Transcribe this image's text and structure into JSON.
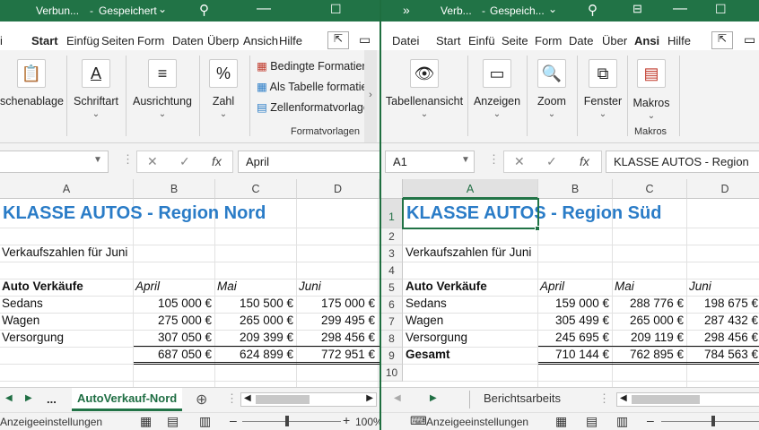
{
  "left": {
    "title": {
      "file": "Verbun...",
      "sep": "-",
      "state": "Gespeichert"
    },
    "tabs": [
      "Start",
      "Einfüg",
      "Seiten",
      "Form",
      "Daten",
      "Überp",
      "Ansich",
      "Hilfe"
    ],
    "tab_partial_first": "i",
    "active_tab": "Start",
    "ribbon": {
      "clipboard": "schenablage",
      "font": "Schriftart",
      "alignment": "Ausrichtung",
      "number": "Zahl",
      "styles": [
        "Bedingte Formatierung",
        "Als Tabelle formatieren",
        "Zellenformatvorlagen"
      ],
      "styles_group": "Formatvorlagen"
    },
    "formula": {
      "name_box": "",
      "value": "April"
    },
    "columns": [
      "A",
      "B",
      "C",
      "D"
    ],
    "sheet": {
      "title": "KLASSE AUTOS - Region Nord",
      "subtitle": "Verkaufszahlen für Juni",
      "header": [
        "Auto Verkäufe",
        "April",
        "Mai",
        "Juni"
      ],
      "rows": [
        [
          "Sedans",
          "105 000 €",
          "150 500 €",
          "175 000 €"
        ],
        [
          "Wagen",
          "275 000 €",
          "265 000 €",
          "299 495 €"
        ],
        [
          "Versorgung",
          "307 050 €",
          "209 399 €",
          "298 456 €"
        ]
      ],
      "total": [
        "",
        "687 050 €",
        "624 899 €",
        "772 951 €"
      ]
    },
    "sheet_tab": "AutoVerkauf-Nord",
    "more_sheets": "...",
    "status": {
      "display": "Anzeigeeinstellungen",
      "zoom": "100%"
    }
  },
  "right": {
    "title": {
      "file": "Verb...",
      "sep": "-",
      "state": "Gespeich..."
    },
    "tabs": [
      "Datei",
      "Start",
      "Einfü",
      "Seite",
      "Form",
      "Date",
      "Über",
      "Ansi",
      "Hilfe"
    ],
    "active_tab": "Ansi",
    "ribbon": {
      "views": "Tabellenansicht",
      "show": "Anzeigen",
      "zoom": "Zoom",
      "window": "Fenster",
      "macros": "Makros",
      "macros_group": "Makros"
    },
    "formula": {
      "name_box": "A1",
      "value": "KLASSE AUTOS - Region"
    },
    "columns": [
      "A",
      "B",
      "C",
      "D"
    ],
    "row_numbers": [
      "1",
      "2",
      "3",
      "4",
      "5",
      "6",
      "7",
      "8",
      "9",
      "10"
    ],
    "sheet": {
      "title": "KLASSE AUTOS - Region Süd",
      "subtitle": "Verkaufszahlen für Juni",
      "header": [
        "Auto Verkäufe",
        "April",
        "Mai",
        "Juni"
      ],
      "rows": [
        [
          "Sedans",
          "159 000 €",
          "288 776 €",
          "198 675 €"
        ],
        [
          "Wagen",
          "305 499 €",
          "265 000 €",
          "287 432 €"
        ],
        [
          "Versorgung",
          "245 695 €",
          "209 119 €",
          "298 456 €"
        ]
      ],
      "total": [
        "Gesamt",
        "710 144 €",
        "762 895 €",
        "784 563 €"
      ]
    },
    "sheet_tab": "Berichtsarbeits",
    "status": {
      "display": "Anzeigeeinstellungen"
    }
  }
}
